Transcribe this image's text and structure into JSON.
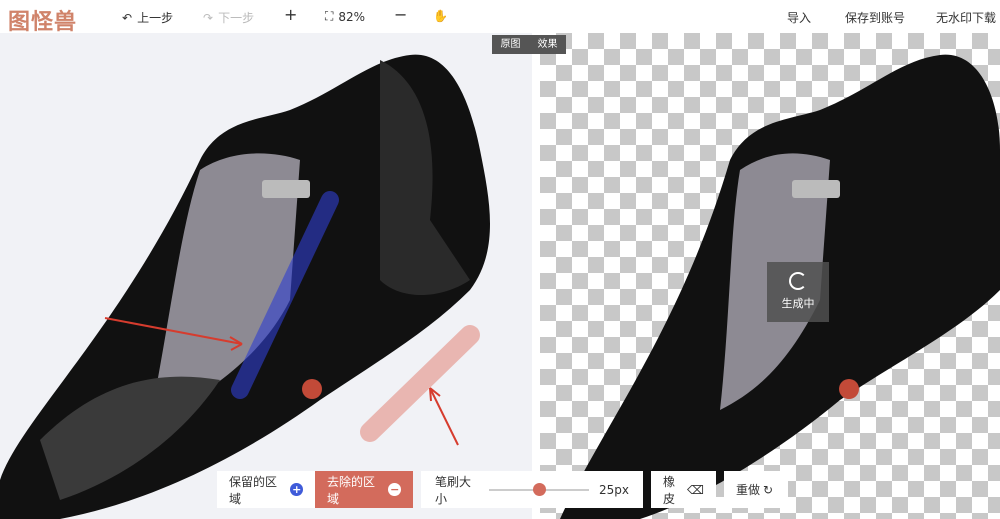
{
  "app": {
    "logo": "图怪兽"
  },
  "toolbar_top": {
    "undo": "上一步",
    "redo": "下一步",
    "zoom": "82%",
    "import": "导入",
    "save_account": "保存到账号",
    "download": "无水印下载"
  },
  "view_toggle": {
    "original": "原图",
    "effect": "效果"
  },
  "status": {
    "generating": "生成中"
  },
  "tools": {
    "keep": "保留的区域",
    "remove": "去除的区域",
    "brush_label": "笔刷大小",
    "brush_value": "25px",
    "brush_fraction": 0.5,
    "eraser": "橡皮",
    "redo": "重做"
  },
  "colors": {
    "accent": "#d36b5c",
    "keep": "#3f5bd9",
    "logo": "#d0836a"
  }
}
